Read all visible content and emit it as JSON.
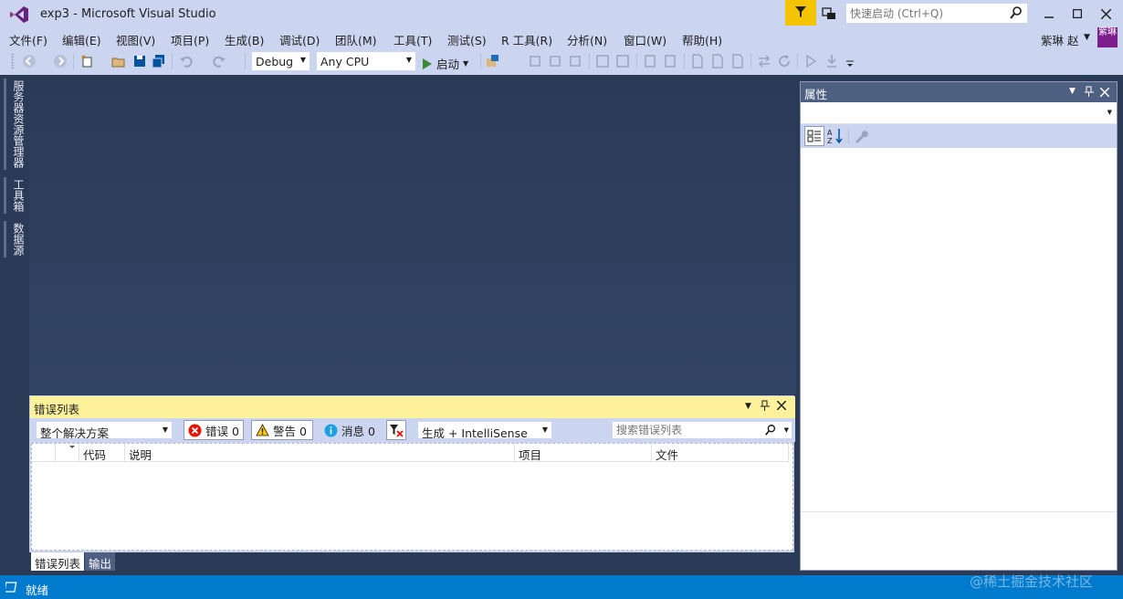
{
  "window": {
    "title": "exp3 - Microsoft Visual Studio",
    "quick_launch_placeholder": "快速启动 (Ctrl+Q)",
    "user_name": "紫琳 赵",
    "avatar_text": "紫琳"
  },
  "menu": [
    "文件(F)",
    "编辑(E)",
    "视图(V)",
    "项目(P)",
    "生成(B)",
    "调试(D)",
    "团队(M)",
    "工具(T)",
    "测试(S)",
    "R 工具(R)",
    "分析(N)",
    "窗口(W)",
    "帮助(H)"
  ],
  "toolbar": {
    "config": "Debug",
    "platform": "Any CPU",
    "start_label": "启动"
  },
  "side_tabs": [
    "服务器资源管理器",
    "工具箱",
    "数据源"
  ],
  "error_list": {
    "title": "错误列表",
    "scope": "整个解决方案",
    "errors_label": "错误 0",
    "warnings_label": "警告 0",
    "messages_label": "消息 0",
    "build_filter": "生成 + IntelliSense",
    "search_placeholder": "搜索错误列表",
    "columns": [
      "代码",
      "说明",
      "项目",
      "文件"
    ]
  },
  "bottom_tabs": [
    "错误列表",
    "输出"
  ],
  "properties": {
    "title": "属性"
  },
  "status": {
    "text": "就绪"
  },
  "watermark": "@稀土掘金技术社区",
  "colors": {
    "chrome": "#ccd5f0",
    "editor_bg": "#2b3a56",
    "status_blue": "#007acc",
    "error_header": "#fff29d",
    "notification": "#f5c400"
  }
}
